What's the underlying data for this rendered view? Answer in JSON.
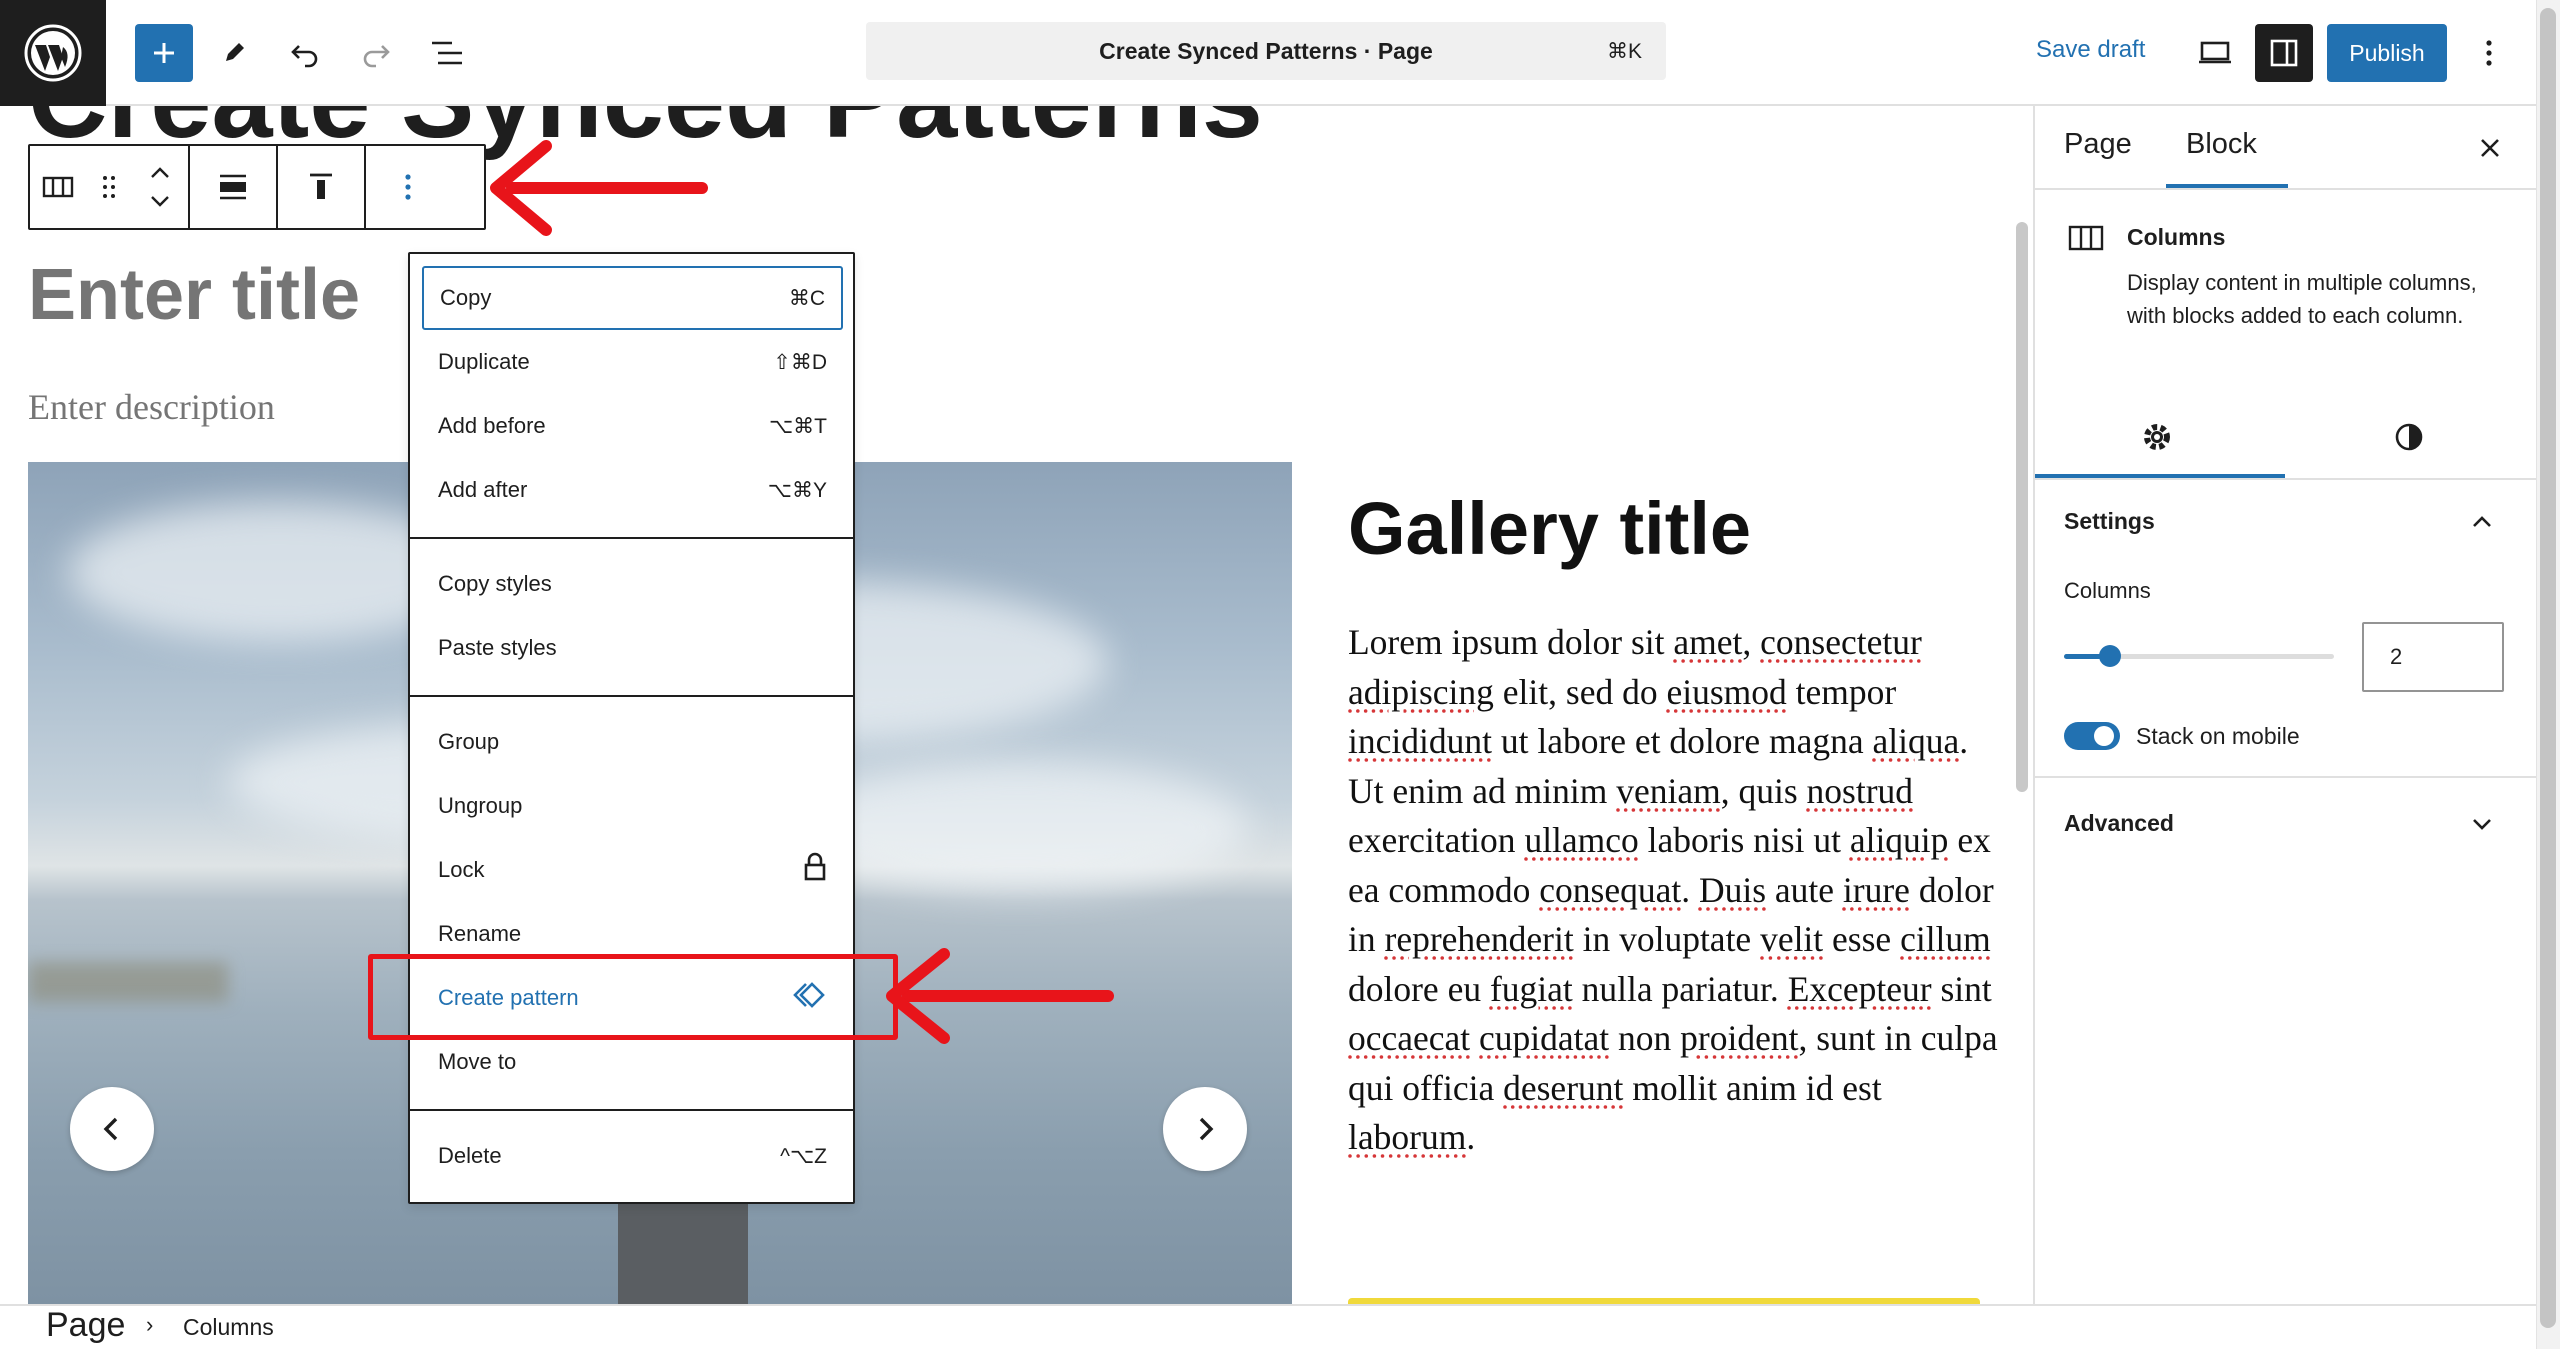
{
  "topbar": {
    "document_title": "Create Synced Patterns · Page",
    "command_shortcut": "⌘K",
    "save_draft": "Save draft",
    "publish": "Publish"
  },
  "canvas": {
    "background_heading": "Create Synced Patterns",
    "enter_title": "Enter title",
    "enter_description": "Enter description",
    "gallery_title": "Gallery title",
    "body_text_segments": [
      {
        "t": "Lorem ipsum dolor sit ",
        "s": false
      },
      {
        "t": "amet",
        "s": true
      },
      {
        "t": ", ",
        "s": false
      },
      {
        "t": "consectetur",
        "s": true
      },
      {
        "t": " ",
        "s": false
      },
      {
        "t": "adipiscing",
        "s": true
      },
      {
        "t": " elit, sed do ",
        "s": false
      },
      {
        "t": "eiusmod",
        "s": true
      },
      {
        "t": " tempor ",
        "s": false
      },
      {
        "t": "incididunt",
        "s": true
      },
      {
        "t": " ut labore et dolore magna ",
        "s": false
      },
      {
        "t": "aliqua",
        "s": true
      },
      {
        "t": ". Ut enim ad minim ",
        "s": false
      },
      {
        "t": "veniam",
        "s": true
      },
      {
        "t": ", quis ",
        "s": false
      },
      {
        "t": "nostrud",
        "s": true
      },
      {
        "t": " exercitation ",
        "s": false
      },
      {
        "t": "ullamco",
        "s": true
      },
      {
        "t": " laboris nisi ut ",
        "s": false
      },
      {
        "t": "aliquip",
        "s": true
      },
      {
        "t": " ex ea commodo ",
        "s": false
      },
      {
        "t": "consequat",
        "s": true
      },
      {
        "t": ". ",
        "s": false
      },
      {
        "t": "Duis",
        "s": true
      },
      {
        "t": " aute ",
        "s": false
      },
      {
        "t": "irure",
        "s": true
      },
      {
        "t": " dolor in ",
        "s": false
      },
      {
        "t": "reprehenderit",
        "s": true
      },
      {
        "t": " in voluptate ",
        "s": false
      },
      {
        "t": "velit",
        "s": true
      },
      {
        "t": " esse ",
        "s": false
      },
      {
        "t": "cillum",
        "s": true
      },
      {
        "t": " dolore eu ",
        "s": false
      },
      {
        "t": "fugiat",
        "s": true
      },
      {
        "t": " nulla pariatur. ",
        "s": false
      },
      {
        "t": "Excepteur",
        "s": true
      },
      {
        "t": " sint ",
        "s": false
      },
      {
        "t": "occaecat",
        "s": true
      },
      {
        "t": " ",
        "s": false
      },
      {
        "t": "cupidatat",
        "s": true
      },
      {
        "t": " non ",
        "s": false
      },
      {
        "t": "proident",
        "s": true
      },
      {
        "t": ", sunt in culpa qui officia ",
        "s": false
      },
      {
        "t": "deserunt",
        "s": true
      },
      {
        "t": " mollit anim id est ",
        "s": false
      },
      {
        "t": "laborum",
        "s": true
      },
      {
        "t": ".",
        "s": false
      }
    ]
  },
  "menu": {
    "items": [
      {
        "label": "Copy",
        "shortcut": "⌘C"
      },
      {
        "label": "Duplicate",
        "shortcut": "⇧⌘D"
      },
      {
        "label": "Add before",
        "shortcut": "⌥⌘T"
      },
      {
        "label": "Add after",
        "shortcut": "⌥⌘Y"
      },
      {
        "label": "Copy styles",
        "shortcut": ""
      },
      {
        "label": "Paste styles",
        "shortcut": ""
      },
      {
        "label": "Group",
        "shortcut": ""
      },
      {
        "label": "Ungroup",
        "shortcut": ""
      },
      {
        "label": "Lock",
        "shortcut": ""
      },
      {
        "label": "Rename",
        "shortcut": ""
      },
      {
        "label": "Create pattern",
        "shortcut": ""
      },
      {
        "label": "Move to",
        "shortcut": ""
      },
      {
        "label": "Delete",
        "shortcut": "^⌥Z"
      }
    ]
  },
  "sidebar": {
    "tab_page": "Page",
    "tab_block": "Block",
    "block_name": "Columns",
    "block_description": "Display content in multiple columns, with blocks added to each column.",
    "settings_header": "Settings",
    "columns_label": "Columns",
    "columns_value": "2",
    "columns_slider_fraction": 0.17,
    "stack_on_mobile_label": "Stack on mobile",
    "stack_on_mobile": true,
    "advanced_header": "Advanced"
  },
  "breadcrumb": {
    "root": "Page",
    "separator": "›",
    "current": "Columns"
  },
  "colors": {
    "accent": "#2271b1",
    "annotation_red": "#e8141a",
    "dark": "#1e1e1e"
  }
}
